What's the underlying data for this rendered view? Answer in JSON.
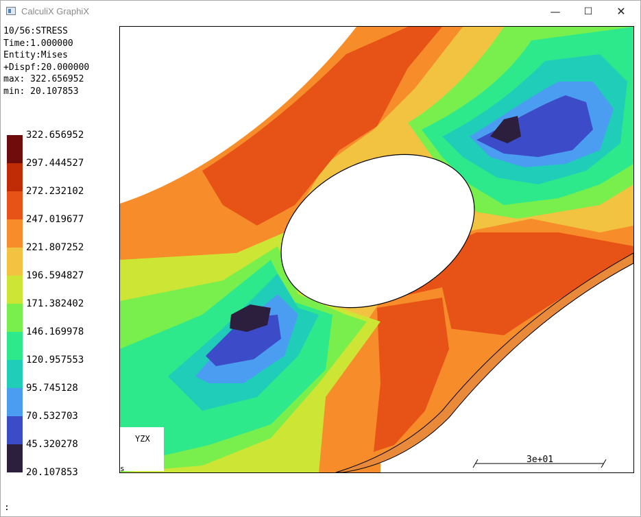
{
  "window": {
    "title": "CalculiX GraphiX",
    "minimize_symbol": "—",
    "maximize_symbol": "☐",
    "close_symbol": "✕"
  },
  "info": {
    "line1": "10/56:STRESS",
    "line2": "Time:1.000000",
    "line3": "Entity:Mises",
    "line4": "+Dispf:20.000000",
    "line5": "max: 322.656952",
    "line6": "min: 20.107853"
  },
  "legend": [
    {
      "value": "322.656952",
      "color": "#6f0d0d"
    },
    {
      "value": "297.444527",
      "color": "#bf2c05"
    },
    {
      "value": "272.232102",
      "color": "#e75216"
    },
    {
      "value": "247.019677",
      "color": "#f78c2b"
    },
    {
      "value": "221.807252",
      "color": "#f2c341"
    },
    {
      "value": "196.594827",
      "color": "#cde535"
    },
    {
      "value": "171.382402",
      "color": "#79ef4d"
    },
    {
      "value": "146.169978",
      "color": "#2de98c"
    },
    {
      "value": "120.957553",
      "color": "#20cdb8"
    },
    {
      "value": "95.745128",
      "color": "#4a9df0"
    },
    {
      "value": "70.532703",
      "color": "#3c4bc7"
    },
    {
      "value": "45.320278",
      "color": "#2b1f3d"
    },
    {
      "value": "20.107853",
      "color": ""
    }
  ],
  "viewport": {
    "axes_label": "YZX",
    "corner_mark": "s",
    "scale_label": "3e+01"
  },
  "command": {
    "prompt": ":"
  }
}
